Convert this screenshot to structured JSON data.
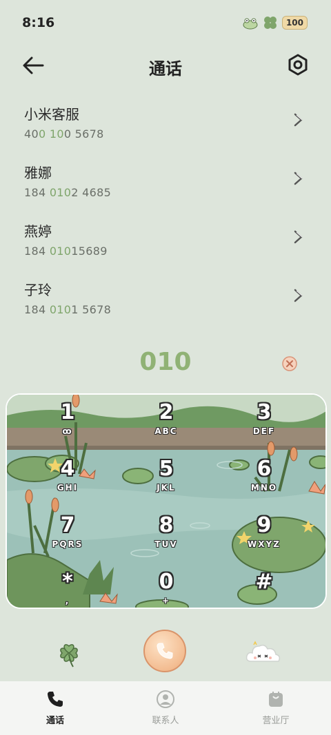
{
  "status_bar": {
    "time": "8:16",
    "battery": "100",
    "icons": [
      "frog-icon",
      "clover-icon"
    ]
  },
  "header": {
    "title": "通话",
    "back_icon": "arrow-left-icon",
    "settings_icon": "hexagon-gear-icon"
  },
  "contacts": [
    {
      "name": "小米客服",
      "number_parts": [
        "40",
        "0",
        " ",
        "10",
        "0 5678"
      ]
    },
    {
      "name": "雅娜",
      "number_parts": [
        "184 ",
        "010",
        "2 4685",
        "",
        ""
      ]
    },
    {
      "name": "燕婷",
      "number_parts": [
        "184 ",
        "010",
        "15689",
        "",
        ""
      ]
    },
    {
      "name": "子玲",
      "number_parts": [
        "184 ",
        "010",
        "1 5678",
        "",
        ""
      ]
    }
  ],
  "dialer": {
    "input_value": "010",
    "accent_color": "#90b275"
  },
  "keypad": {
    "keys": [
      {
        "digit": "1",
        "letters": "ꝏ"
      },
      {
        "digit": "2",
        "letters": "ABC"
      },
      {
        "digit": "3",
        "letters": "DEF"
      },
      {
        "digit": "4",
        "letters": "GHI"
      },
      {
        "digit": "5",
        "letters": "JKL"
      },
      {
        "digit": "6",
        "letters": "MNO"
      },
      {
        "digit": "7",
        "letters": "PQRS"
      },
      {
        "digit": "8",
        "letters": "TUV"
      },
      {
        "digit": "9",
        "letters": "WXYZ"
      },
      {
        "digit": "*",
        "letters": ","
      },
      {
        "digit": "0",
        "letters": "+"
      },
      {
        "digit": "#",
        "letters": ""
      }
    ]
  },
  "actions": {
    "left_icon": "clover-icon",
    "call_icon": "phone-icon",
    "right_icon": "cloud-icon"
  },
  "bottom_nav": [
    {
      "label": "通话",
      "icon": "phone-icon",
      "active": true
    },
    {
      "label": "联系人",
      "icon": "person-icon",
      "active": false
    },
    {
      "label": "营业厅",
      "icon": "bag-icon",
      "active": false
    }
  ]
}
